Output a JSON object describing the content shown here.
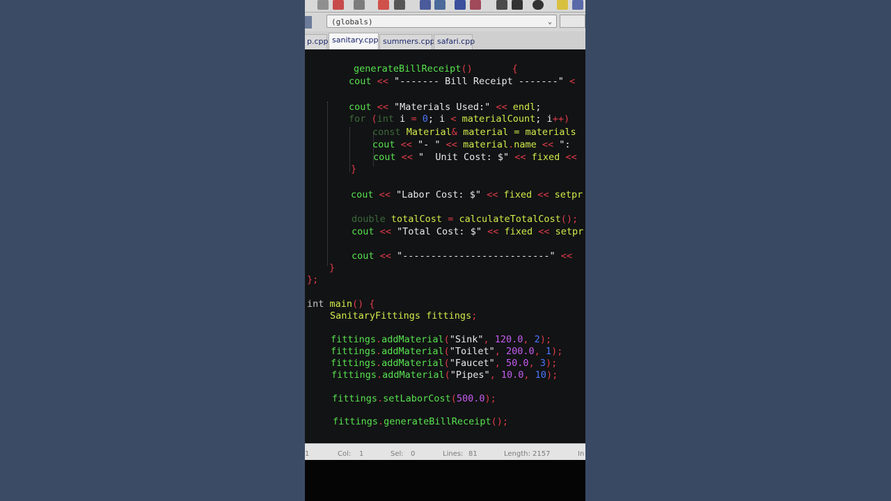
{
  "toolbar": {
    "buttons": [
      "save-icon",
      "record-icon",
      "print-icon",
      "undo-icon",
      "redo-icon",
      "find-icon",
      "find-replace-icon",
      "bookmark-icon",
      "bookmark-list-icon",
      "macro-icon",
      "tool-icon",
      "stop-icon",
      "palette-icon",
      "window-icon"
    ]
  },
  "scope_combo": {
    "value": "(globals)"
  },
  "tabs": [
    {
      "label": "p.cpp",
      "active": false
    },
    {
      "label": "sanitary.cpp",
      "active": true
    },
    {
      "label": "summers.cpp",
      "active": false
    },
    {
      "label": "safari.cpp",
      "active": false
    }
  ],
  "code": [
    [
      [
        "generateBillReceipt",
        "grn"
      ],
      [
        "()",
        "op"
      ],
      [
        "       {",
        "op"
      ]
    ],
    [
      [
        "cout",
        "grn"
      ],
      [
        " << ",
        "op"
      ],
      [
        "\"------- Bill Receipt -------\"",
        "str"
      ],
      [
        " <",
        "op"
      ]
    ],
    [
      [
        "cout",
        "grn"
      ],
      [
        " << ",
        "op"
      ],
      [
        "\"Materials Used:\"",
        "str"
      ],
      [
        " << ",
        "op"
      ],
      [
        "endl",
        "ylw"
      ],
      [
        ";",
        "pun"
      ]
    ],
    [
      [
        "for",
        "dim"
      ],
      [
        " (",
        "op"
      ],
      [
        "int",
        "dim"
      ],
      [
        " i ",
        "wht"
      ],
      [
        "= ",
        "op"
      ],
      [
        "0",
        "blu"
      ],
      [
        "; i ",
        "wht"
      ],
      [
        "< ",
        "op"
      ],
      [
        "materialCount",
        "ylw"
      ],
      [
        "; i",
        "wht"
      ],
      [
        "++)",
        "op"
      ]
    ],
    [
      [
        "const",
        "dim"
      ],
      [
        " Material",
        "ylw"
      ],
      [
        "&",
        "op"
      ],
      [
        " material = materials",
        "ylw"
      ]
    ],
    [
      [
        "cout",
        "grn"
      ],
      [
        " << ",
        "op"
      ],
      [
        "\"- \"",
        "str"
      ],
      [
        " << ",
        "op"
      ],
      [
        "material",
        "ylw"
      ],
      [
        ".",
        "op"
      ],
      [
        "name",
        "ylw"
      ],
      [
        " << ",
        "op"
      ],
      [
        "\":",
        "str"
      ]
    ],
    [
      [
        "cout",
        "grn"
      ],
      [
        " << ",
        "op"
      ],
      [
        "\"  Unit Cost: $\"",
        "str"
      ],
      [
        " << ",
        "op"
      ],
      [
        "fixed",
        "ylw"
      ],
      [
        " <<",
        "op"
      ]
    ],
    [
      [
        "}",
        "op"
      ]
    ],
    [
      [
        "cout",
        "grn"
      ],
      [
        " << ",
        "op"
      ],
      [
        "\"Labor Cost: $\"",
        "str"
      ],
      [
        " << ",
        "op"
      ],
      [
        "fixed",
        "ylw"
      ],
      [
        " << ",
        "op"
      ],
      [
        "setpr",
        "ylw"
      ]
    ],
    [
      [
        "double",
        "dim"
      ],
      [
        " totalCost",
        "ylw"
      ],
      [
        " = ",
        "op"
      ],
      [
        "calculateTotalCost",
        "ylw"
      ],
      [
        "();",
        "op"
      ]
    ],
    [
      [
        "cout",
        "grn"
      ],
      [
        " << ",
        "op"
      ],
      [
        "\"Total Cost: $\"",
        "str"
      ],
      [
        " << ",
        "op"
      ],
      [
        "fixed",
        "ylw"
      ],
      [
        " << ",
        "op"
      ],
      [
        "setpr",
        "ylw"
      ]
    ],
    [
      [
        "cout",
        "grn"
      ],
      [
        " << ",
        "op"
      ],
      [
        "\"--------------------------\"",
        "str"
      ],
      [
        " <<",
        "op"
      ]
    ],
    [
      [
        "}",
        "op"
      ]
    ],
    [
      [
        "};",
        "op"
      ]
    ],
    [
      [
        "int",
        "kw"
      ],
      [
        " main",
        "ylw"
      ],
      [
        "() {",
        "op"
      ]
    ],
    [
      [
        "SanitaryFittings fittings",
        "ylw"
      ],
      [
        ";",
        "op"
      ]
    ],
    [
      [
        "fittings",
        "grn"
      ],
      [
        ".",
        "op"
      ],
      [
        "addMaterial",
        "grn"
      ],
      [
        "(",
        "op"
      ],
      [
        "\"Sink\"",
        "str"
      ],
      [
        ", ",
        "op"
      ],
      [
        "120.0",
        "num"
      ],
      [
        ", ",
        "op"
      ],
      [
        "2",
        "blu"
      ],
      [
        ");",
        "op"
      ]
    ],
    [
      [
        "fittings",
        "grn"
      ],
      [
        ".",
        "op"
      ],
      [
        "addMaterial",
        "grn"
      ],
      [
        "(",
        "op"
      ],
      [
        "\"Toilet\"",
        "str"
      ],
      [
        ", ",
        "op"
      ],
      [
        "200.0",
        "num"
      ],
      [
        ", ",
        "op"
      ],
      [
        "1",
        "blu"
      ],
      [
        ");",
        "op"
      ]
    ],
    [
      [
        "fittings",
        "grn"
      ],
      [
        ".",
        "op"
      ],
      [
        "addMaterial",
        "grn"
      ],
      [
        "(",
        "op"
      ],
      [
        "\"Faucet\"",
        "str"
      ],
      [
        ", ",
        "op"
      ],
      [
        "50.0",
        "num"
      ],
      [
        ", ",
        "op"
      ],
      [
        "3",
        "blu"
      ],
      [
        ");",
        "op"
      ]
    ],
    [
      [
        "fittings",
        "grn"
      ],
      [
        ".",
        "op"
      ],
      [
        "addMaterial",
        "grn"
      ],
      [
        "(",
        "op"
      ],
      [
        "\"Pipes\"",
        "str"
      ],
      [
        ", ",
        "op"
      ],
      [
        "10.0",
        "num"
      ],
      [
        ", ",
        "op"
      ],
      [
        "10",
        "blu"
      ],
      [
        ");",
        "op"
      ]
    ],
    [
      [
        "fittings",
        "grn"
      ],
      [
        ".",
        "op"
      ],
      [
        "setLaborCost",
        "grn"
      ],
      [
        "(",
        "op"
      ],
      [
        "500.0",
        "num"
      ],
      [
        ");",
        "op"
      ]
    ],
    [
      [
        "fittings",
        "grn"
      ],
      [
        ".",
        "op"
      ],
      [
        "generateBillReceipt",
        "grn"
      ],
      [
        "();",
        "op"
      ]
    ]
  ],
  "status": {
    "line": "1",
    "col_label": "Col:",
    "col": "1",
    "sel_label": "Sel:",
    "sel": "0",
    "lines_label": "Lines:",
    "lines": "81",
    "length_label": "Length:",
    "length": "2157",
    "mode": "In"
  }
}
